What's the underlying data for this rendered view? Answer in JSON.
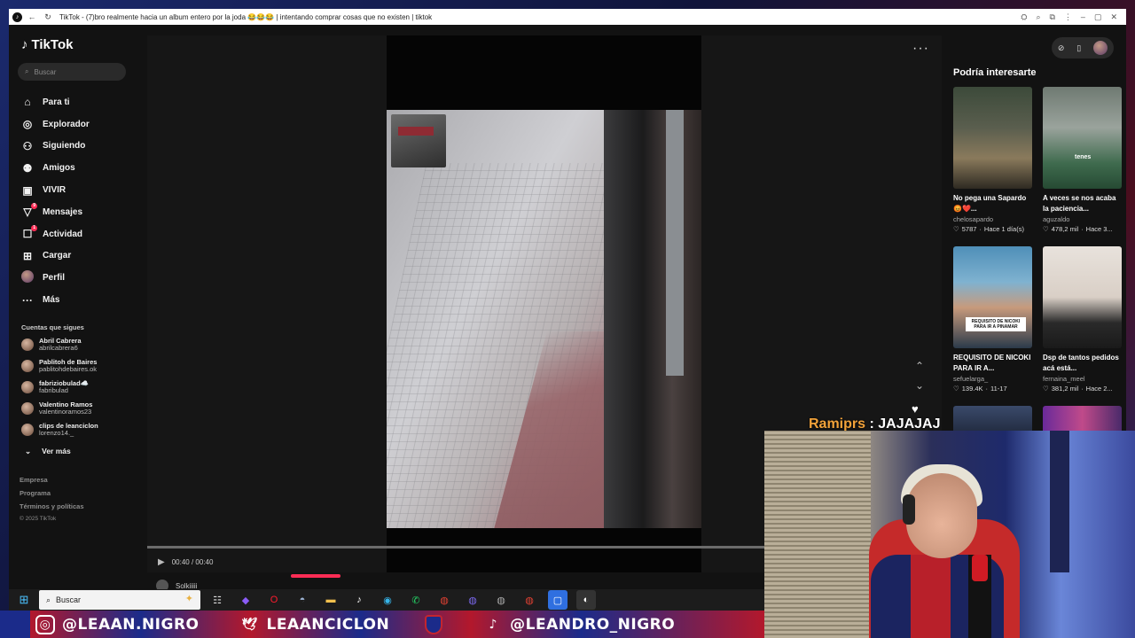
{
  "browser": {
    "tab_title": "TikTok - (7)bro realmente hacia un album entero por la joda 😂😂😂 | intentando comprar cosas que no existen | tiktok",
    "icons": [
      "back-icon",
      "refresh-icon",
      "translate-icon",
      "zoom-icon",
      "extensions-icon",
      "menu-icon",
      "minimize-icon",
      "maximize-icon",
      "close-icon"
    ]
  },
  "sidebar": {
    "logo": "TikTok",
    "search_placeholder": "Buscar",
    "nav": [
      {
        "label": "Para ti",
        "icon": "home-icon"
      },
      {
        "label": "Explorador",
        "icon": "compass-icon"
      },
      {
        "label": "Siguiendo",
        "icon": "following-icon"
      },
      {
        "label": "Amigos",
        "icon": "friends-icon"
      },
      {
        "label": "VIVIR",
        "icon": "live-icon"
      },
      {
        "label": "Mensajes",
        "icon": "messages-icon",
        "badge": "9"
      },
      {
        "label": "Actividad",
        "icon": "activity-icon",
        "badge": "1"
      },
      {
        "label": "Cargar",
        "icon": "upload-icon"
      },
      {
        "label": "Perfil",
        "icon": "avatar"
      },
      {
        "label": "Más",
        "icon": "more-icon"
      }
    ],
    "following_title": "Cuentas que sigues",
    "following": [
      {
        "name": "Abril Cabrera",
        "handle": "abrilcabrera6"
      },
      {
        "name": "Pablitoh de Baires",
        "handle": "pablitohdebaires.ok"
      },
      {
        "name": "fabriziobulad☁️",
        "handle": "fabribulad"
      },
      {
        "name": "Valentino Ramos",
        "handle": "valentinoramos23"
      },
      {
        "name": "clips de leanciclon",
        "handle": "lorenzo14._"
      }
    ],
    "see_more": "Ver más",
    "footer": [
      "Empresa",
      "Programa",
      "Términos y políticas"
    ],
    "copyright": "© 2025 TikTok"
  },
  "player": {
    "time": "00:40 / 00:40",
    "progress": 1.0,
    "author": "Solkiiiii"
  },
  "recommendations": {
    "title": "Podría interesarte",
    "items": [
      {
        "title": "No pega una Sapardo 😡❤️...",
        "author": "chelosapardo",
        "likes": "5787",
        "time": "Hace 1 día(s)"
      },
      {
        "title": "A veces se nos acaba la paciencia...",
        "author": "aguzaldo",
        "likes": "478,2 mil",
        "time": "Hace 3...",
        "overlay": "tenes"
      },
      {
        "title": "REQUISITO DE NICOKI PARA IR A...",
        "author": "sefuelarga_",
        "likes": "139.4K",
        "time": "11-17",
        "overlay": "REQUISITO DE NICOKI PARA IR A PINAMAR"
      },
      {
        "title": "Dsp de tantos pedidos acá está...",
        "author": "fernaina_meel",
        "likes": "381,2 mil",
        "time": "Hace 2..."
      }
    ]
  },
  "chat": {
    "user": "Ramiprs",
    "separator": " : ",
    "message": "JAJAJAJ"
  },
  "taskbar": {
    "search_placeholder": "Buscar",
    "apps": [
      "task-view-icon",
      "copilot-icon",
      "opera-icon",
      "app-icon",
      "file-explorer-icon",
      "tiktok-icon",
      "edge-icon",
      "whatsapp-icon",
      "chrome-icon",
      "chrome-icon",
      "chrome-icon",
      "chrome-icon",
      "app-icon",
      "obs-icon"
    ]
  },
  "banner": {
    "instagram": "@LEAAN.NIGRO",
    "twitter": "LEAANCICLON",
    "tiktok": "@LEANDRO_NIGRO"
  },
  "colors": {
    "accent": "#fe2c55",
    "chat_user": "#f2a23a",
    "banner_red": "#b3182c",
    "banner_blue": "#1b2b8a"
  }
}
